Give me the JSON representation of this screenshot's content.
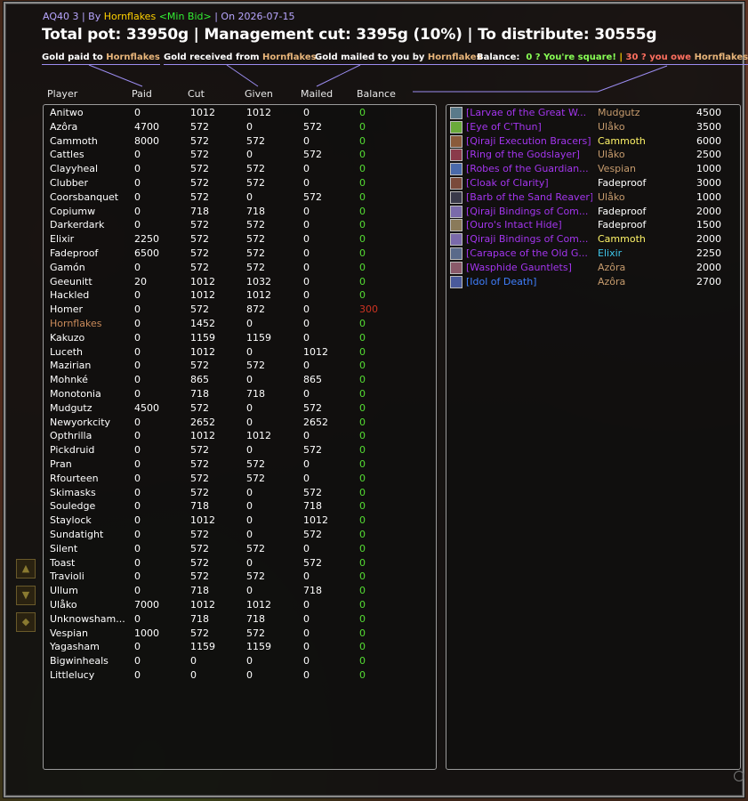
{
  "header": {
    "subtitle_prefix": "AQ40 3 | By ",
    "creator": "Hornflakes",
    "mode": "<Min Bid>",
    "subtitle_suffix": " | On 2026-07-15",
    "headline": "Total pot: 33950g | Management cut: 3395g (10%) | To distribute: 30555g"
  },
  "legends": {
    "paid_prefix": "Gold paid to ",
    "received_prefix": "Gold received from ",
    "mailed_prefix": "Gold mailed to you by ",
    "name": "Hornflakes",
    "balance_label": "Balance:",
    "balance_square": "0 ? You're square!",
    "separator": "|",
    "balance_owe_prefix": "30 ? you owe ",
    "balance_owe_amount": "30g",
    "trailing_separator": "|"
  },
  "columns": {
    "player": "Player",
    "paid": "Paid",
    "cut": "Cut",
    "given": "Given",
    "mailed": "Mailed",
    "balance": "Balance"
  },
  "players": [
    {
      "name": "Anitwo",
      "paid": "0",
      "cut": "1012",
      "given": "1012",
      "mailed": "0",
      "balance": "0"
    },
    {
      "name": "Azôra",
      "paid": "4700",
      "cut": "572",
      "given": "0",
      "mailed": "572",
      "balance": "0"
    },
    {
      "name": "Cammoth",
      "paid": "8000",
      "cut": "572",
      "given": "572",
      "mailed": "0",
      "balance": "0"
    },
    {
      "name": "Cattles",
      "paid": "0",
      "cut": "572",
      "given": "0",
      "mailed": "572",
      "balance": "0"
    },
    {
      "name": "Clayyheal",
      "paid": "0",
      "cut": "572",
      "given": "572",
      "mailed": "0",
      "balance": "0"
    },
    {
      "name": "Clubber",
      "paid": "0",
      "cut": "572",
      "given": "572",
      "mailed": "0",
      "balance": "0"
    },
    {
      "name": "Coorsbanquet",
      "paid": "0",
      "cut": "572",
      "given": "0",
      "mailed": "572",
      "balance": "0"
    },
    {
      "name": "Copiumw",
      "paid": "0",
      "cut": "718",
      "given": "718",
      "mailed": "0",
      "balance": "0"
    },
    {
      "name": "Darkerdark",
      "paid": "0",
      "cut": "572",
      "given": "572",
      "mailed": "0",
      "balance": "0"
    },
    {
      "name": "Elixir",
      "paid": "2250",
      "cut": "572",
      "given": "572",
      "mailed": "0",
      "balance": "0"
    },
    {
      "name": "Fadeproof",
      "paid": "6500",
      "cut": "572",
      "given": "572",
      "mailed": "0",
      "balance": "0"
    },
    {
      "name": "Gamón",
      "paid": "0",
      "cut": "572",
      "given": "572",
      "mailed": "0",
      "balance": "0"
    },
    {
      "name": "Geeunitt",
      "paid": "20",
      "cut": "1012",
      "given": "1032",
      "mailed": "0",
      "balance": "0"
    },
    {
      "name": "Hackled",
      "paid": "0",
      "cut": "1012",
      "given": "1012",
      "mailed": "0",
      "balance": "0"
    },
    {
      "name": "Homer",
      "paid": "0",
      "cut": "572",
      "given": "872",
      "mailed": "0",
      "balance": "300"
    },
    {
      "name": "Hornflakes",
      "paid": "0",
      "cut": "1452",
      "given": "0",
      "mailed": "0",
      "balance": "0"
    },
    {
      "name": "Kakuzo",
      "paid": "0",
      "cut": "1159",
      "given": "1159",
      "mailed": "0",
      "balance": "0"
    },
    {
      "name": "Luceth",
      "paid": "0",
      "cut": "1012",
      "given": "0",
      "mailed": "1012",
      "balance": "0"
    },
    {
      "name": "Mazirian",
      "paid": "0",
      "cut": "572",
      "given": "572",
      "mailed": "0",
      "balance": "0"
    },
    {
      "name": "Mohnké",
      "paid": "0",
      "cut": "865",
      "given": "0",
      "mailed": "865",
      "balance": "0"
    },
    {
      "name": "Monotonia",
      "paid": "0",
      "cut": "718",
      "given": "718",
      "mailed": "0",
      "balance": "0"
    },
    {
      "name": "Mudgutz",
      "paid": "4500",
      "cut": "572",
      "given": "0",
      "mailed": "572",
      "balance": "0"
    },
    {
      "name": "Newyorkcity",
      "paid": "0",
      "cut": "2652",
      "given": "0",
      "mailed": "2652",
      "balance": "0"
    },
    {
      "name": "Opthrilla",
      "paid": "0",
      "cut": "1012",
      "given": "1012",
      "mailed": "0",
      "balance": "0"
    },
    {
      "name": "Pickdruid",
      "paid": "0",
      "cut": "572",
      "given": "0",
      "mailed": "572",
      "balance": "0"
    },
    {
      "name": "Pran",
      "paid": "0",
      "cut": "572",
      "given": "572",
      "mailed": "0",
      "balance": "0"
    },
    {
      "name": "Rfourteen",
      "paid": "0",
      "cut": "572",
      "given": "572",
      "mailed": "0",
      "balance": "0"
    },
    {
      "name": "Skimasks",
      "paid": "0",
      "cut": "572",
      "given": "0",
      "mailed": "572",
      "balance": "0"
    },
    {
      "name": "Souledge",
      "paid": "0",
      "cut": "718",
      "given": "0",
      "mailed": "718",
      "balance": "0"
    },
    {
      "name": "Staylock",
      "paid": "0",
      "cut": "1012",
      "given": "0",
      "mailed": "1012",
      "balance": "0"
    },
    {
      "name": "Sundatight",
      "paid": "0",
      "cut": "572",
      "given": "0",
      "mailed": "572",
      "balance": "0"
    },
    {
      "name": "Silent",
      "paid": "0",
      "cut": "572",
      "given": "572",
      "mailed": "0",
      "balance": "0"
    },
    {
      "name": "Toast",
      "paid": "0",
      "cut": "572",
      "given": "0",
      "mailed": "572",
      "balance": "0"
    },
    {
      "name": "Travioli",
      "paid": "0",
      "cut": "572",
      "given": "572",
      "mailed": "0",
      "balance": "0"
    },
    {
      "name": "Ullum",
      "paid": "0",
      "cut": "718",
      "given": "0",
      "mailed": "718",
      "balance": "0"
    },
    {
      "name": "Ulåko",
      "paid": "7000",
      "cut": "1012",
      "given": "1012",
      "mailed": "0",
      "balance": "0"
    },
    {
      "name": "Unknowsham...",
      "paid": "0",
      "cut": "718",
      "given": "718",
      "mailed": "0",
      "balance": "0"
    },
    {
      "name": "Vespian",
      "paid": "1000",
      "cut": "572",
      "given": "572",
      "mailed": "0",
      "balance": "0"
    },
    {
      "name": "Yagasham",
      "paid": "0",
      "cut": "1159",
      "given": "1159",
      "mailed": "0",
      "balance": "0"
    },
    {
      "name": "Bigwinheals",
      "paid": "0",
      "cut": "0",
      "given": "0",
      "mailed": "0",
      "balance": "0"
    },
    {
      "name": "Littlelucy",
      "paid": "0",
      "cut": "0",
      "given": "0",
      "mailed": "0",
      "balance": "0"
    }
  ],
  "loot": [
    {
      "item": "[Larvae of the Great W...",
      "winner": "Mudgutz",
      "winner_color": "#c69b6d",
      "price": "4500",
      "quality": "epic",
      "icon_color": "#5a7a8a"
    },
    {
      "item": "[Eye of C'Thun]",
      "winner": "Ulåko",
      "winner_color": "#c69b6d",
      "price": "3500",
      "quality": "epic",
      "icon_color": "#6aaa3a"
    },
    {
      "item": "[Qiraji Execution Bracers]",
      "winner": "Cammoth",
      "winner_color": "#fff468",
      "price": "6000",
      "quality": "epic",
      "icon_color": "#8a5a3a"
    },
    {
      "item": "[Ring of the Godslayer]",
      "winner": "Ulåko",
      "winner_color": "#c69b6d",
      "price": "2500",
      "quality": "epic",
      "icon_color": "#8a3a4a"
    },
    {
      "item": "[Robes of the Guardian...",
      "winner": "Vespian",
      "winner_color": "#c69b6d",
      "price": "1000",
      "quality": "epic",
      "icon_color": "#4a6aaa"
    },
    {
      "item": "[Cloak of Clarity]",
      "winner": "Fadeproof",
      "winner_color": "#ffffff",
      "price": "3000",
      "quality": "epic",
      "icon_color": "#7a4a3a"
    },
    {
      "item": "[Barb of the Sand Reaver]",
      "winner": "Ulåko",
      "winner_color": "#c69b6d",
      "price": "1000",
      "quality": "epic",
      "icon_color": "#3a3a4a"
    },
    {
      "item": "[Qiraji Bindings of Com...",
      "winner": "Fadeproof",
      "winner_color": "#ffffff",
      "price": "2000",
      "quality": "epic",
      "icon_color": "#7a6aaa"
    },
    {
      "item": "[Ouro's Intact Hide]",
      "winner": "Fadeproof",
      "winner_color": "#ffffff",
      "price": "1500",
      "quality": "epic",
      "icon_color": "#8a7a5a"
    },
    {
      "item": "[Qiraji Bindings of Com...",
      "winner": "Cammoth",
      "winner_color": "#fff468",
      "price": "2000",
      "quality": "epic",
      "icon_color": "#7a6aaa"
    },
    {
      "item": "[Carapace of the Old G...",
      "winner": "Elixir",
      "winner_color": "#3fc7eb",
      "price": "2250",
      "quality": "epic",
      "icon_color": "#5a6a8a"
    },
    {
      "item": "[Wasphide Gauntlets]",
      "winner": "Azôra",
      "winner_color": "#c69b6d",
      "price": "2000",
      "quality": "epic",
      "icon_color": "#8a5a6a"
    },
    {
      "item": "[Idol of Death]",
      "winner": "Azôra",
      "winner_color": "#c69b6d",
      "price": "2700",
      "quality": "rare",
      "icon_color": "#4a5a9a"
    }
  ],
  "colors": {
    "accent_line": "#9b8cf0",
    "balance_ok": "#55dd33",
    "balance_due": "#cc3322",
    "epic": "#a335ee",
    "rare": "#3f7fff"
  }
}
